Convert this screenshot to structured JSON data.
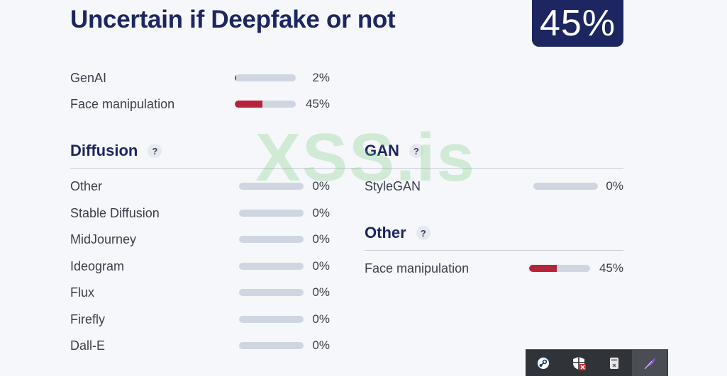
{
  "title": "Uncertain if Deepfake or not",
  "score": "45%",
  "colors": {
    "accent": "#1d2660",
    "fill": "#b7233a",
    "track": "#cfd6e2"
  },
  "summary": [
    {
      "label": "GenAI",
      "value": 2,
      "pct": "2%"
    },
    {
      "label": "Face manipulation",
      "value": 45,
      "pct": "45%"
    }
  ],
  "diffusion": {
    "heading": "Diffusion",
    "help": "?",
    "items": [
      {
        "label": "Other",
        "value": 0,
        "pct": "0%"
      },
      {
        "label": "Stable Diffusion",
        "value": 0,
        "pct": "0%"
      },
      {
        "label": "MidJourney",
        "value": 0,
        "pct": "0%"
      },
      {
        "label": "Ideogram",
        "value": 0,
        "pct": "0%"
      },
      {
        "label": "Flux",
        "value": 0,
        "pct": "0%"
      },
      {
        "label": "Firefly",
        "value": 0,
        "pct": "0%"
      },
      {
        "label": "Dall-E",
        "value": 0,
        "pct": "0%"
      }
    ]
  },
  "gan": {
    "heading": "GAN",
    "help": "?",
    "items": [
      {
        "label": "StyleGAN",
        "value": 0,
        "pct": "0%"
      }
    ]
  },
  "other": {
    "heading": "Other",
    "help": "?",
    "items": [
      {
        "label": "Face manipulation",
        "value": 45,
        "pct": "45%"
      }
    ]
  },
  "watermark": "XSS.is",
  "tray": [
    {
      "icon": "steam-icon"
    },
    {
      "icon": "security-shield-icon"
    },
    {
      "icon": "usb-drive-icon"
    },
    {
      "icon": "feather-icon"
    }
  ]
}
